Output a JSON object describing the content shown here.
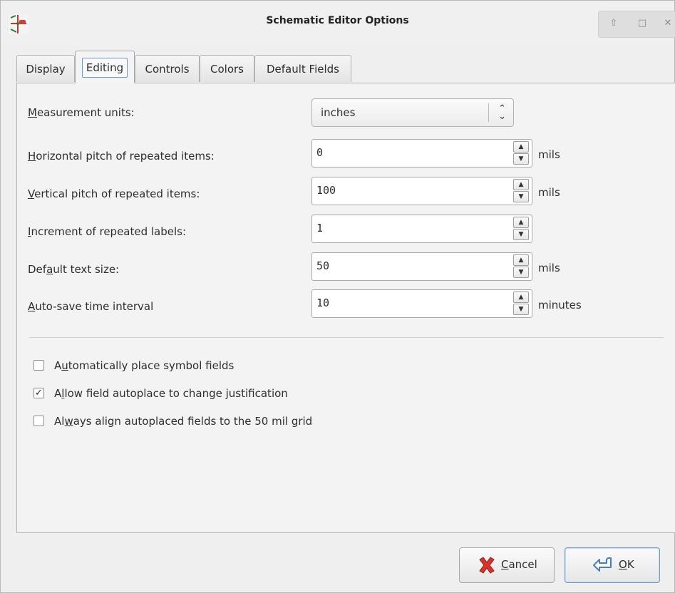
{
  "window": {
    "title": "Schematic Editor Options",
    "icon": "kicad-eeschema-icon",
    "controls": [
      "shade-icon",
      "maximize-icon",
      "close-icon"
    ]
  },
  "tabs": [
    {
      "label": "Display",
      "active": false
    },
    {
      "label": "Editing",
      "active": true
    },
    {
      "label": "Controls",
      "active": false
    },
    {
      "label": "Colors",
      "active": false
    },
    {
      "label": "Default Fields",
      "active": false
    }
  ],
  "form": {
    "measurement_units": {
      "label_mnemonic": "M",
      "label_rest": "easurement units:",
      "value": "inches"
    },
    "horizontal_pitch": {
      "label_mnemonic": "H",
      "label_rest": "orizontal pitch of repeated items:",
      "value": "0",
      "unit": "mils"
    },
    "vertical_pitch": {
      "label_mnemonic": "V",
      "label_rest": "ertical pitch of repeated items:",
      "value": "100",
      "unit": "mils"
    },
    "label_increment": {
      "label_mnemonic": "I",
      "label_rest": "ncrement of repeated labels:",
      "value": "1"
    },
    "default_text_size": {
      "label_pre": "Def",
      "label_mnemonic": "a",
      "label_rest": "ult text size:",
      "value": "50",
      "unit": "mils"
    },
    "autosave_interval": {
      "label_mnemonic": "A",
      "label_rest": "uto-save time interval",
      "value": "10",
      "unit": "minutes"
    }
  },
  "checkboxes": [
    {
      "pre": "A",
      "mnemonic": "u",
      "rest": "tomatically place symbol fields",
      "checked": false
    },
    {
      "pre": "A",
      "mnemonic": "l",
      "rest": "low field autoplace to change justification",
      "checked": true
    },
    {
      "pre": "Al",
      "mnemonic": "w",
      "rest": "ays align autoplaced fields to the 50 mil grid",
      "checked": false
    }
  ],
  "buttons": {
    "cancel": {
      "mnemonic": "C",
      "rest": "ancel",
      "icon": "cancel-x-icon"
    },
    "ok": {
      "mnemonic": "O",
      "rest": "K",
      "icon": "enter-arrow-icon"
    }
  },
  "colors": {
    "accent": "#6f98c8",
    "cancel_icon": "#d9342b",
    "ok_icon": "#4a7fbf"
  }
}
